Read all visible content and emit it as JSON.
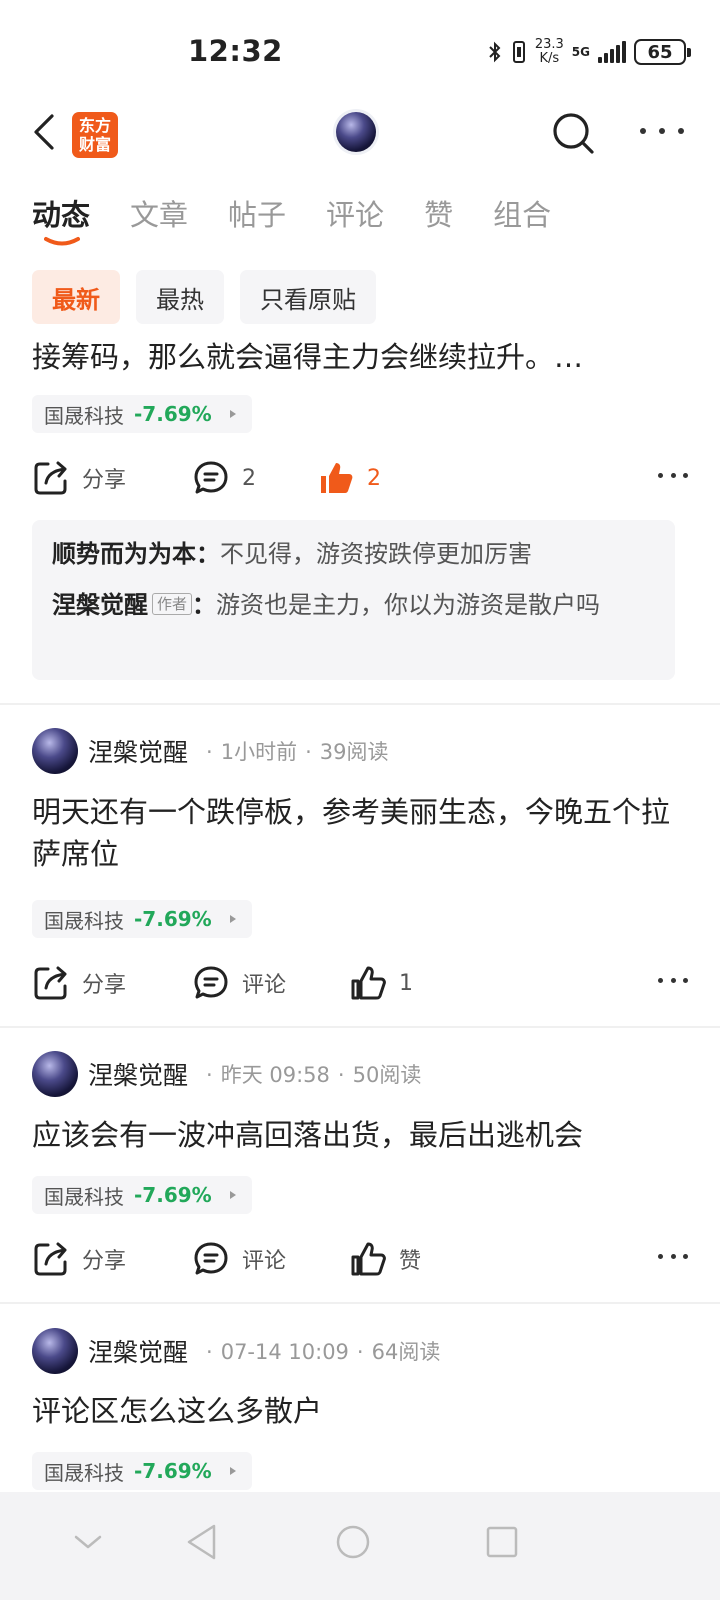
{
  "status_bar": {
    "time": "12:32",
    "net_speed_value": "23.3",
    "net_speed_unit": "K/s",
    "network": "5G",
    "battery": "65"
  },
  "header": {
    "logo_text": "东方财富",
    "back_icon": "chevron-left-icon",
    "search_icon": "search-icon",
    "more_icon": "more-horizontal-icon"
  },
  "tabs": [
    {
      "label": "动态",
      "active": true
    },
    {
      "label": "文章",
      "active": false
    },
    {
      "label": "帖子",
      "active": false
    },
    {
      "label": "评论",
      "active": false
    },
    {
      "label": "赞",
      "active": false
    },
    {
      "label": "组合",
      "active": false
    }
  ],
  "filters": [
    {
      "label": "最新",
      "active": true
    },
    {
      "label": "最热",
      "active": false
    },
    {
      "label": "只看原贴",
      "active": false
    }
  ],
  "colors": {
    "accent": "#f05a1a",
    "stock_down": "#22a85a",
    "tag_bg": "#f5f5f7"
  },
  "feed": [
    {
      "text": "接筹码，那么就会逼得主力会继续拉升。…",
      "stock": {
        "name": "国晟科技",
        "change": "-7.69%"
      },
      "actions": {
        "share": "分享",
        "comment": "2",
        "like": "2",
        "liked": true
      },
      "replies": [
        {
          "user": "顺势而为为本",
          "sep": "：",
          "text": "不见得，游资按跌停更加厉害"
        },
        {
          "user": "涅槃觉醒",
          "tag": "作者",
          "sep": "：",
          "text": "游资也是主力，你以为游资是散户吗"
        }
      ]
    },
    {
      "author": "涅槃觉醒",
      "time": "1小时前",
      "reads": "39阅读",
      "text": "明天还有一个跌停板，参考美丽生态，今晚五个拉萨席位",
      "stock": {
        "name": "国晟科技",
        "change": "-7.69%"
      },
      "actions": {
        "share": "分享",
        "comment": "评论",
        "like": "1",
        "liked": false
      }
    },
    {
      "author": "涅槃觉醒",
      "time": "昨天 09:58",
      "reads": "50阅读",
      "text": "应该会有一波冲高回落出货，最后出逃机会",
      "stock": {
        "name": "国晟科技",
        "change": "-7.69%"
      },
      "actions": {
        "share": "分享",
        "comment": "评论",
        "like": "赞",
        "liked": false
      }
    },
    {
      "author": "涅槃觉醒",
      "time": "07-14 10:09",
      "reads": "64阅读",
      "text": "评论区怎么这么多散户",
      "stock": {
        "name": "国晟科技",
        "change": "-7.69%"
      }
    }
  ],
  "nav_bar": {
    "icons": [
      "chevron-down-icon",
      "back-triangle-icon",
      "home-circle-icon",
      "recents-square-icon"
    ]
  }
}
